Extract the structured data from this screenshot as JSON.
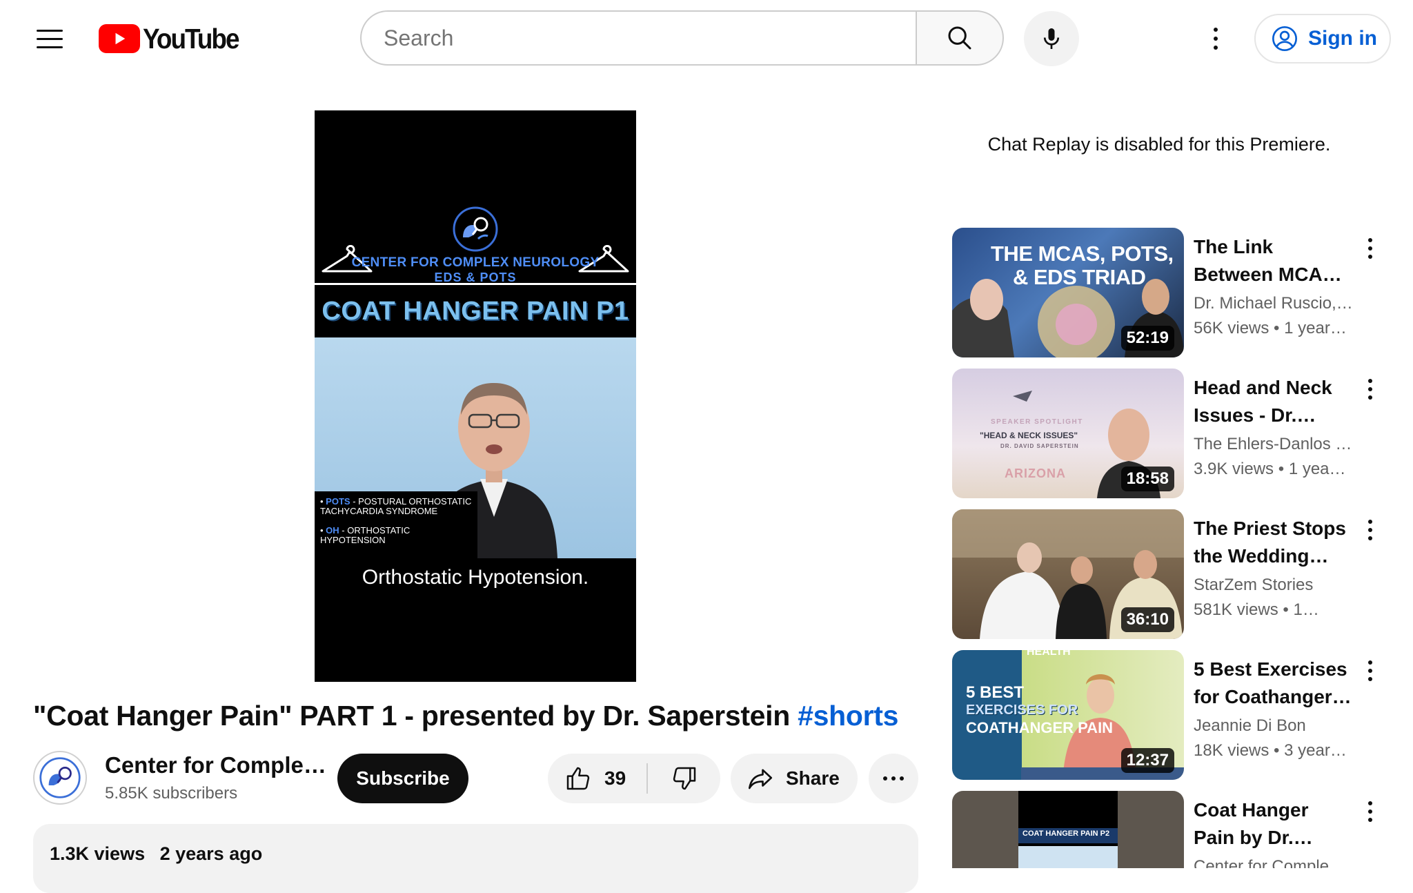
{
  "header": {
    "logo_text": "YouTube",
    "search_placeholder": "Search",
    "sign_in_label": "Sign in"
  },
  "player": {
    "brand_line1": "CENTER FOR COMPLEX NEUROLOGY",
    "brand_line2": "EDS & POTS",
    "title_card": "COAT HANGER PAIN P1",
    "overlay_pots_abbr": "POTS",
    "overlay_pots_text": "- POSTURAL ORTHOSTATIC TACHYCARDIA SYNDROME",
    "overlay_oh_abbr": "OH",
    "overlay_oh_text": "- ORTHOSTATIC HYPOTENSION",
    "caption": "Orthostatic Hypotension."
  },
  "video": {
    "title": "\"Coat Hanger Pain\" PART 1 - presented by Dr. Saperstein ",
    "hashtag": "#shorts",
    "channel_name": "Center for Comple…",
    "subscribers": "5.85K subscribers",
    "subscribe_label": "Subscribe",
    "like_count": "39",
    "share_label": "Share",
    "views": "1.3K views",
    "age": "2 years ago"
  },
  "sidebar": {
    "chat_replay_notice": "Chat Replay is disabled for this Premiere.",
    "recommendations": [
      {
        "title": "The Link Between MCAS, POTS, a…",
        "channel": "Dr. Michael Ruscio,…",
        "views": "56K views",
        "age": "1 year…",
        "duration": "52:19",
        "thumb_text_1": "THE MCAS, POTS,",
        "thumb_text_2": "& EDS TRIAD"
      },
      {
        "title": "Head and Neck Issues - Dr. Davi…",
        "channel": "The Ehlers-Danlos …",
        "views": "3.9K views",
        "age": "1 yea…",
        "duration": "18:58",
        "thumb_text_1": "SPEAKER SPOTLIGHT",
        "thumb_text_2": "\"HEAD & NECK ISSUES\"",
        "thumb_text_3": "DR. DAVID SAPERSTEIN",
        "thumb_text_4": "ARIZONA"
      },
      {
        "title": "The Priest Stops the Wedding…",
        "channel": "StarZem Stories",
        "views": "581K views",
        "age": "1…",
        "duration": "36:10"
      },
      {
        "title": "5 Best Exercises for Coathanger…",
        "channel": "Jeannie Di Bon",
        "views": "18K views",
        "age": "3 year…",
        "duration": "12:37",
        "thumb_text_1": "5 BEST",
        "thumb_text_2": "EXERCISES FOR",
        "thumb_text_3": "COATHANGER PAIN",
        "thumb_text_4": "HEALTH"
      },
      {
        "title": "Coat Hanger Pain by Dr. David…",
        "channel": "Center for Complex…",
        "views": "",
        "age": "",
        "duration": "",
        "thumb_text_1": "COAT HANGER PAIN P2"
      }
    ]
  },
  "colors": {
    "brand_red": "#ff0000",
    "link_blue": "#065fd4",
    "chip_gray": "#f2f2f2",
    "secondary_text": "#606060"
  },
  "icons": [
    "menu-icon",
    "youtube-play-icon",
    "search-icon",
    "mic-icon",
    "more-vert-icon",
    "account-icon",
    "thumb-up-icon",
    "thumb-down-icon",
    "share-icon",
    "more-horiz-icon"
  ]
}
